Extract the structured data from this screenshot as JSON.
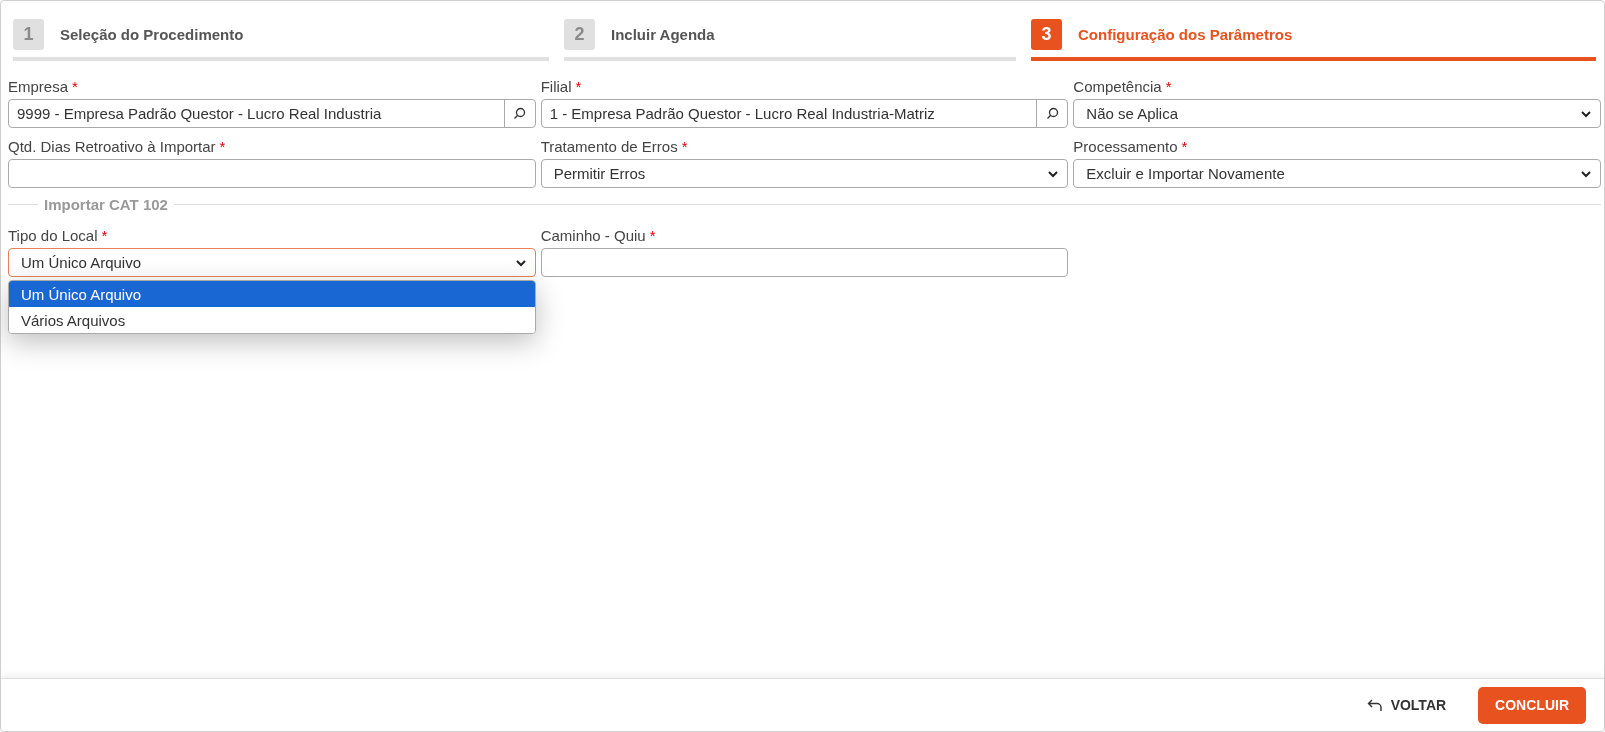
{
  "steps": [
    {
      "number": "1",
      "label": "Seleção do Procedimento",
      "selected": false
    },
    {
      "number": "2",
      "label": "Incluir Agenda",
      "selected": false
    },
    {
      "number": "3",
      "label": "Configuração dos Parâmetros",
      "selected": true
    }
  ],
  "fields": [
    {
      "kind": "lookup",
      "label": "Empresa",
      "required_mark": "*",
      "value": "9999 - Empresa Padrão Questor - Lucro Real Industria"
    },
    {
      "kind": "lookup",
      "label": "Filial",
      "required_mark": "*",
      "value": "1 - Empresa Padrão Questor - Lucro Real Industria-Matriz"
    },
    {
      "kind": "select",
      "label": "Competência",
      "required_mark": "*",
      "value": "Não se Aplica"
    },
    {
      "kind": "text",
      "label": "Qtd. Dias Retroativo à Importar",
      "required_mark": "*"
    },
    {
      "kind": "select",
      "label": "Tratamento de Erros",
      "required_mark": "*",
      "value": "Permitir Erros"
    },
    {
      "kind": "select",
      "label": "Processamento",
      "required_mark": "*",
      "value": "Excluir e Importar Novamente"
    }
  ],
  "section": {
    "title": "Importar CAT 102",
    "fields": [
      {
        "kind": "select",
        "label": "Tipo do Local",
        "required_mark": "*",
        "value": "Um Único Arquivo",
        "expanded": true,
        "options": [
          {
            "label": "Um Único Arquivo",
            "selected": true
          },
          {
            "label": "Vários Arquivos",
            "selected": false
          }
        ]
      },
      {
        "kind": "text",
        "label": "Caminho - Quiu",
        "required_mark": "*"
      }
    ]
  },
  "footer": {
    "back": "VOLTAR",
    "finish": "CONCLUIR"
  }
}
